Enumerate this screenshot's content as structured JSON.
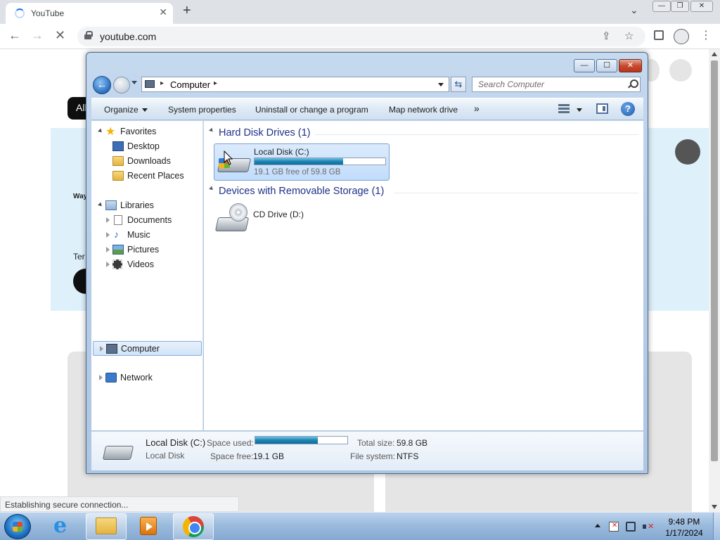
{
  "browser": {
    "tab_title": "YouTube",
    "tab_close": "✕",
    "new_tab": "+",
    "url": "youtube.com",
    "status": "Establishing secure connection...",
    "back": "←",
    "forward": "→",
    "stop": "✕",
    "share": "⇪",
    "bookmark": "☆",
    "menu": "⋮",
    "tab_search": "⌄",
    "window_minimize": "—",
    "window_restore": "❐",
    "window_close": "✕"
  },
  "youtube_bg": {
    "chip_all": "All",
    "text_way": "Way",
    "text_ter": "Ter"
  },
  "explorer": {
    "caption_minimize": "—",
    "caption_maximize": "☐",
    "caption_close": "✕",
    "back": "←",
    "address": {
      "sep": "▸",
      "text": "Computer"
    },
    "refresh": "⇆",
    "search_placeholder": "Search Computer",
    "commands": {
      "organize": "Organize",
      "system_properties": "System properties",
      "uninstall": "Uninstall or change a program",
      "map_drive": "Map network drive",
      "more": "»"
    },
    "help": "?",
    "nav": {
      "favorites": "Favorites",
      "desktop": "Desktop",
      "downloads": "Downloads",
      "recent_places": "Recent Places",
      "libraries": "Libraries",
      "documents": "Documents",
      "music": "Music",
      "pictures": "Pictures",
      "videos": "Videos",
      "computer": "Computer",
      "network": "Network"
    },
    "groups": {
      "hard_disk": "Hard Disk Drives (1)",
      "removable": "Devices with Removable Storage (1)"
    },
    "drive_c": {
      "name": "Local Disk (C:)",
      "free_text": "19.1 GB free of 59.8 GB",
      "used_fraction": 0.68
    },
    "drive_d": {
      "name": "CD Drive (D:)"
    },
    "details": {
      "name": "Local Disk (C:)",
      "type": "Local Disk",
      "space_used_label": "Space used:",
      "space_free_label": "Space free:",
      "space_free_value": "19.1 GB",
      "total_size_label": "Total size:",
      "total_size_value": "59.8 GB",
      "file_system_label": "File system:",
      "file_system_value": "NTFS"
    }
  },
  "taskbar": {
    "time": "9:48 PM",
    "date": "1/17/2024",
    "ie_glyph": "e"
  },
  "colors": {
    "group_header": "#1e3287",
    "progress_fill": "#1b84b5"
  }
}
